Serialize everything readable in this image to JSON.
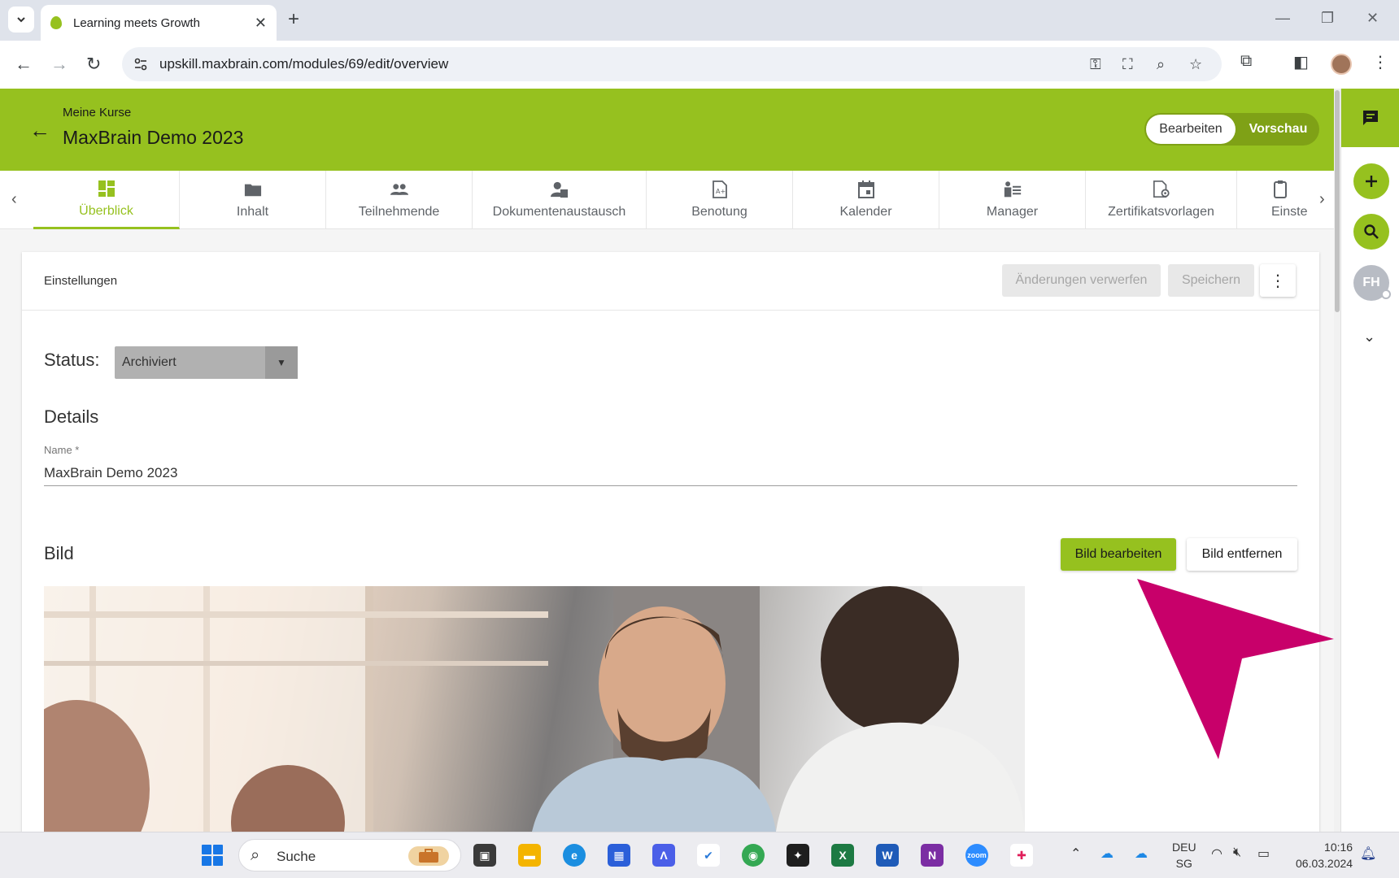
{
  "browser": {
    "tab_title": "Learning meets Growth",
    "url": "upskill.maxbrain.com/modules/69/edit/overview"
  },
  "header": {
    "breadcrumb": "Meine Kurse",
    "title": "MaxBrain Demo 2023",
    "mode_edit": "Bearbeiten",
    "mode_preview": "Vorschau"
  },
  "tabs": [
    {
      "label": "Überblick",
      "icon": "dashboard-icon",
      "active": true
    },
    {
      "label": "Inhalt",
      "icon": "folder-icon"
    },
    {
      "label": "Teilnehmende",
      "icon": "people-icon"
    },
    {
      "label": "Dokumentenaustausch",
      "icon": "document-exchange-icon"
    },
    {
      "label": "Benotung",
      "icon": "grade-icon"
    },
    {
      "label": "Kalender",
      "icon": "calendar-icon"
    },
    {
      "label": "Manager",
      "icon": "manager-icon"
    },
    {
      "label": "Zertifikatsvorlagen",
      "icon": "certificate-icon"
    },
    {
      "label": "Einste",
      "icon": "settings-icon"
    }
  ],
  "card": {
    "title": "Einstellungen",
    "discard_label": "Änderungen verwerfen",
    "save_label": "Speichern"
  },
  "status": {
    "label": "Status:",
    "value": "Archiviert"
  },
  "details": {
    "heading": "Details",
    "name_label": "Name *",
    "name_value": "MaxBrain Demo 2023"
  },
  "image_section": {
    "heading": "Bild",
    "edit_label": "Bild bearbeiten",
    "remove_label": "Bild entfernen"
  },
  "rail": {
    "avatar_initials": "FH"
  },
  "taskbar": {
    "search_placeholder": "Suche",
    "lang_line1": "DEU",
    "lang_line2": "SG",
    "time": "10:16",
    "date": "06.03.2024"
  },
  "colors": {
    "brand": "#96c11f",
    "annotation": "#c8006a"
  }
}
